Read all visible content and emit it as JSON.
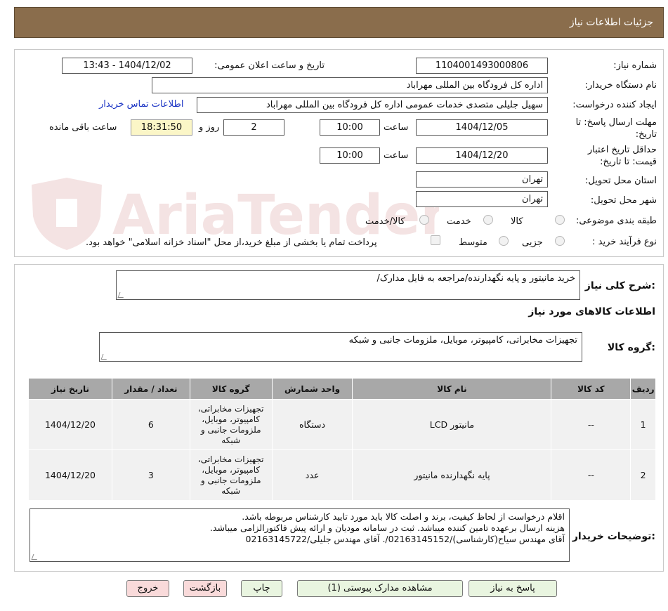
{
  "header": {
    "title": "جزئیات اطلاعات نیاز"
  },
  "watermark_text": "AriaTender.neT",
  "form": {
    "need_number_label": "شماره نیاز:",
    "need_number": "1104001493000806",
    "announce_label": "تاریخ و ساعت اعلان عمومی:",
    "announce_value": "1404/12/02 - 13:43",
    "buyer_org_label": "نام دستگاه خریدار:",
    "buyer_org": "اداره کل فرودگاه بین المللی مهراباد",
    "requester_label": "ایجاد کننده درخواست:",
    "requester": "سهیل جلیلی متصدی خدمات عمومی اداره کل فرودگاه بین المللی مهراباد",
    "contact_link": "اطلاعات تماس خریدار",
    "deadline_label_1": "مهلت ارسال پاسخ: تا",
    "deadline_label_2": "تاریخ:",
    "deadline_date": "1404/12/05",
    "time_label": "ساعت",
    "deadline_time": "10:00",
    "days_value": "2",
    "days_label": "روز و",
    "remaining_time": "18:31:50",
    "remaining_label": "ساعت باقی مانده",
    "validity_label_1": "حداقل تاریخ اعتبار",
    "validity_label_2": "قیمت: تا تاریخ:",
    "validity_date": "1404/12/20",
    "validity_time": "10:00",
    "province_label": "استان محل تحویل:",
    "province": "تهران",
    "city_label": "شهر محل تحویل:",
    "city": "تهران",
    "category_label": "طبقه بندی موضوعی:",
    "category_options": [
      "کالا",
      "خدمت",
      "کالا/خدمت"
    ],
    "process_label": "نوع فرآیند خرید :",
    "process_options": [
      "جزیی",
      "متوسط"
    ],
    "payment_note": "پرداخت تمام یا بخشی از مبلغ خرید،از محل \"اسناد خزانه اسلامی\" خواهد بود."
  },
  "details": {
    "summary_label": "شرح کلی نیاز:",
    "summary": "خرید مانیتور و پایه نگهدارنده/مراجعه به فایل مدارک/",
    "goods_info_title": "اطلاعات کالاهای مورد نیاز",
    "goods_group_label": "گروه کالا:",
    "goods_group": "تجهیزات مخابراتی، کامپیوتر، موبایل، ملزومات جانبی و شبکه"
  },
  "table": {
    "headers": [
      "ردیف",
      "کد کالا",
      "نام کالا",
      "واحد شمارش",
      "گروه کالا",
      "تعداد / مقدار",
      "تاریخ نیاز"
    ],
    "rows": [
      [
        "1",
        "--",
        "مانیتور LCD",
        "دستگاه",
        "تجهیزات مخابراتی، کامپیوتر، موبایل، ملزومات جانبی و شبکه",
        "6",
        "1404/12/20"
      ],
      [
        "2",
        "--",
        "پایه نگهدارنده مانیتور",
        "عدد",
        "تجهیزات مخابراتی، کامپیوتر، موبایل، ملزومات جانبی و شبکه",
        "3",
        "1404/12/20"
      ]
    ]
  },
  "buyer_notes": {
    "label": "توضیحات خریدار:",
    "line1": "اقلام درخواست از لحاظ کیفیت، برند و اصلت کالا باید مورد تایید کارشناس مربوطه باشد.",
    "line2": "هزینه ارسال برعهده تامین کننده میباشد. ثبت در سامانه مودیان و ارائه پیش فاکتورالزامی میباشد.",
    "line3": "آقای مهندس سیاح(کارشناسی)/02163145152/. آقای مهندس جلیلی/02163145722"
  },
  "buttons": {
    "reply": "پاسخ به نیاز",
    "attachments": "مشاهده مدارک پیوستی (1)",
    "print": "چاپ",
    "back": "بازگشت",
    "exit": "خروج"
  }
}
